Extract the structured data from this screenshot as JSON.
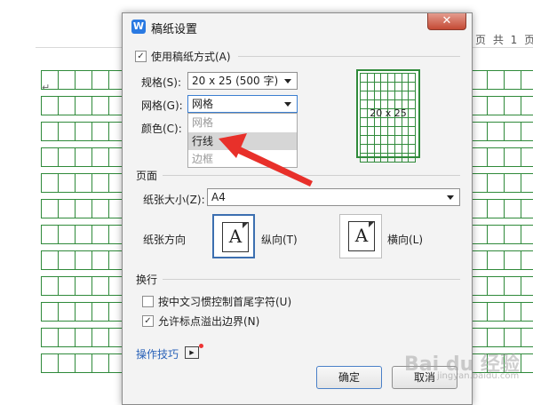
{
  "document": {
    "page_info": "页 共 1 页"
  },
  "dialog": {
    "title": "稿纸设置",
    "app_icon_letter": "W",
    "close_symbol": "✕",
    "use_manuscript": {
      "label": "使用稿纸方式(A)",
      "checked": true
    },
    "spec": {
      "label": "规格(S):",
      "value": "20 x 25 (500 字)"
    },
    "grid": {
      "label": "网格(G):",
      "value": "网格",
      "options": [
        "网格",
        "行线",
        "边框"
      ],
      "highlighted": "行线"
    },
    "color": {
      "label": "颜色(C):"
    },
    "preview": {
      "label": "20 x 25",
      "grid_color": "#2f8a3a"
    },
    "page_section": {
      "title": "页面",
      "paper_size": {
        "label": "纸张大小(Z):",
        "value": "A4"
      },
      "orientation": {
        "label": "纸张方向",
        "portrait": "纵向(T)",
        "landscape": "横向(L)",
        "selected": "portrait",
        "glyph": "A"
      }
    },
    "wrap_section": {
      "title": "换行",
      "chinese_control": {
        "label": "按中文习惯控制首尾字符(U)",
        "checked": false
      },
      "allow_punct": {
        "label": "允许标点溢出边界(N)",
        "checked": true
      }
    },
    "tips": {
      "label": "操作技巧"
    },
    "buttons": {
      "ok": "确定",
      "cancel": "取消"
    }
  },
  "watermark": {
    "text": "Bai du 经验",
    "sub": "jingyan.baidu.com"
  },
  "colors": {
    "accent": "#3c6fb0",
    "grid": "#2f8a3a",
    "arrow": "#e8302a",
    "link": "#2a62b8"
  }
}
